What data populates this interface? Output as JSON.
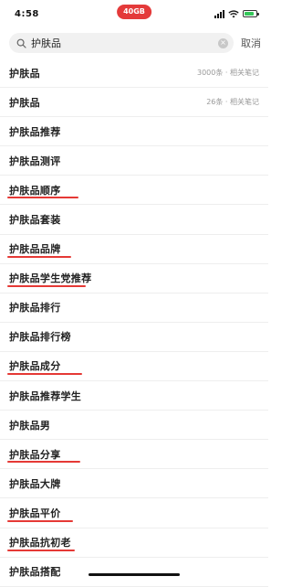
{
  "status_bar": {
    "time": "4:58",
    "pill_text": "40GB"
  },
  "search": {
    "value": "护肤品",
    "cancel_label": "取消"
  },
  "colors": {
    "accent_red": "#e53935",
    "battery_green": "#34c759"
  },
  "suggestions": [
    {
      "text": "护肤品",
      "meta": "3000条 · 相关笔记",
      "underline": false
    },
    {
      "text": "护肤品",
      "meta": "26条 · 相关笔记",
      "underline": false
    },
    {
      "text": "护肤品推荐",
      "meta": "",
      "underline": false
    },
    {
      "text": "护肤品测评",
      "meta": "",
      "underline": false
    },
    {
      "text": "护肤品顺序",
      "meta": "",
      "underline": true
    },
    {
      "text": "护肤品套装",
      "meta": "",
      "underline": false
    },
    {
      "text": "护肤品品牌",
      "meta": "",
      "underline": true
    },
    {
      "text": "护肤品学生党推荐",
      "meta": "",
      "underline": true
    },
    {
      "text": "护肤品排行",
      "meta": "",
      "underline": false
    },
    {
      "text": "护肤品排行榜",
      "meta": "",
      "underline": false
    },
    {
      "text": "护肤品成分",
      "meta": "",
      "underline": true
    },
    {
      "text": "护肤品推荐学生",
      "meta": "",
      "underline": false
    },
    {
      "text": "护肤品男",
      "meta": "",
      "underline": false
    },
    {
      "text": "护肤品分享",
      "meta": "",
      "underline": true
    },
    {
      "text": "护肤品大牌",
      "meta": "",
      "underline": false
    },
    {
      "text": "护肤品平价",
      "meta": "",
      "underline": true
    },
    {
      "text": "护肤品抗初老",
      "meta": "",
      "underline": true
    },
    {
      "text": "护肤品搭配",
      "meta": "",
      "underline": false
    }
  ]
}
